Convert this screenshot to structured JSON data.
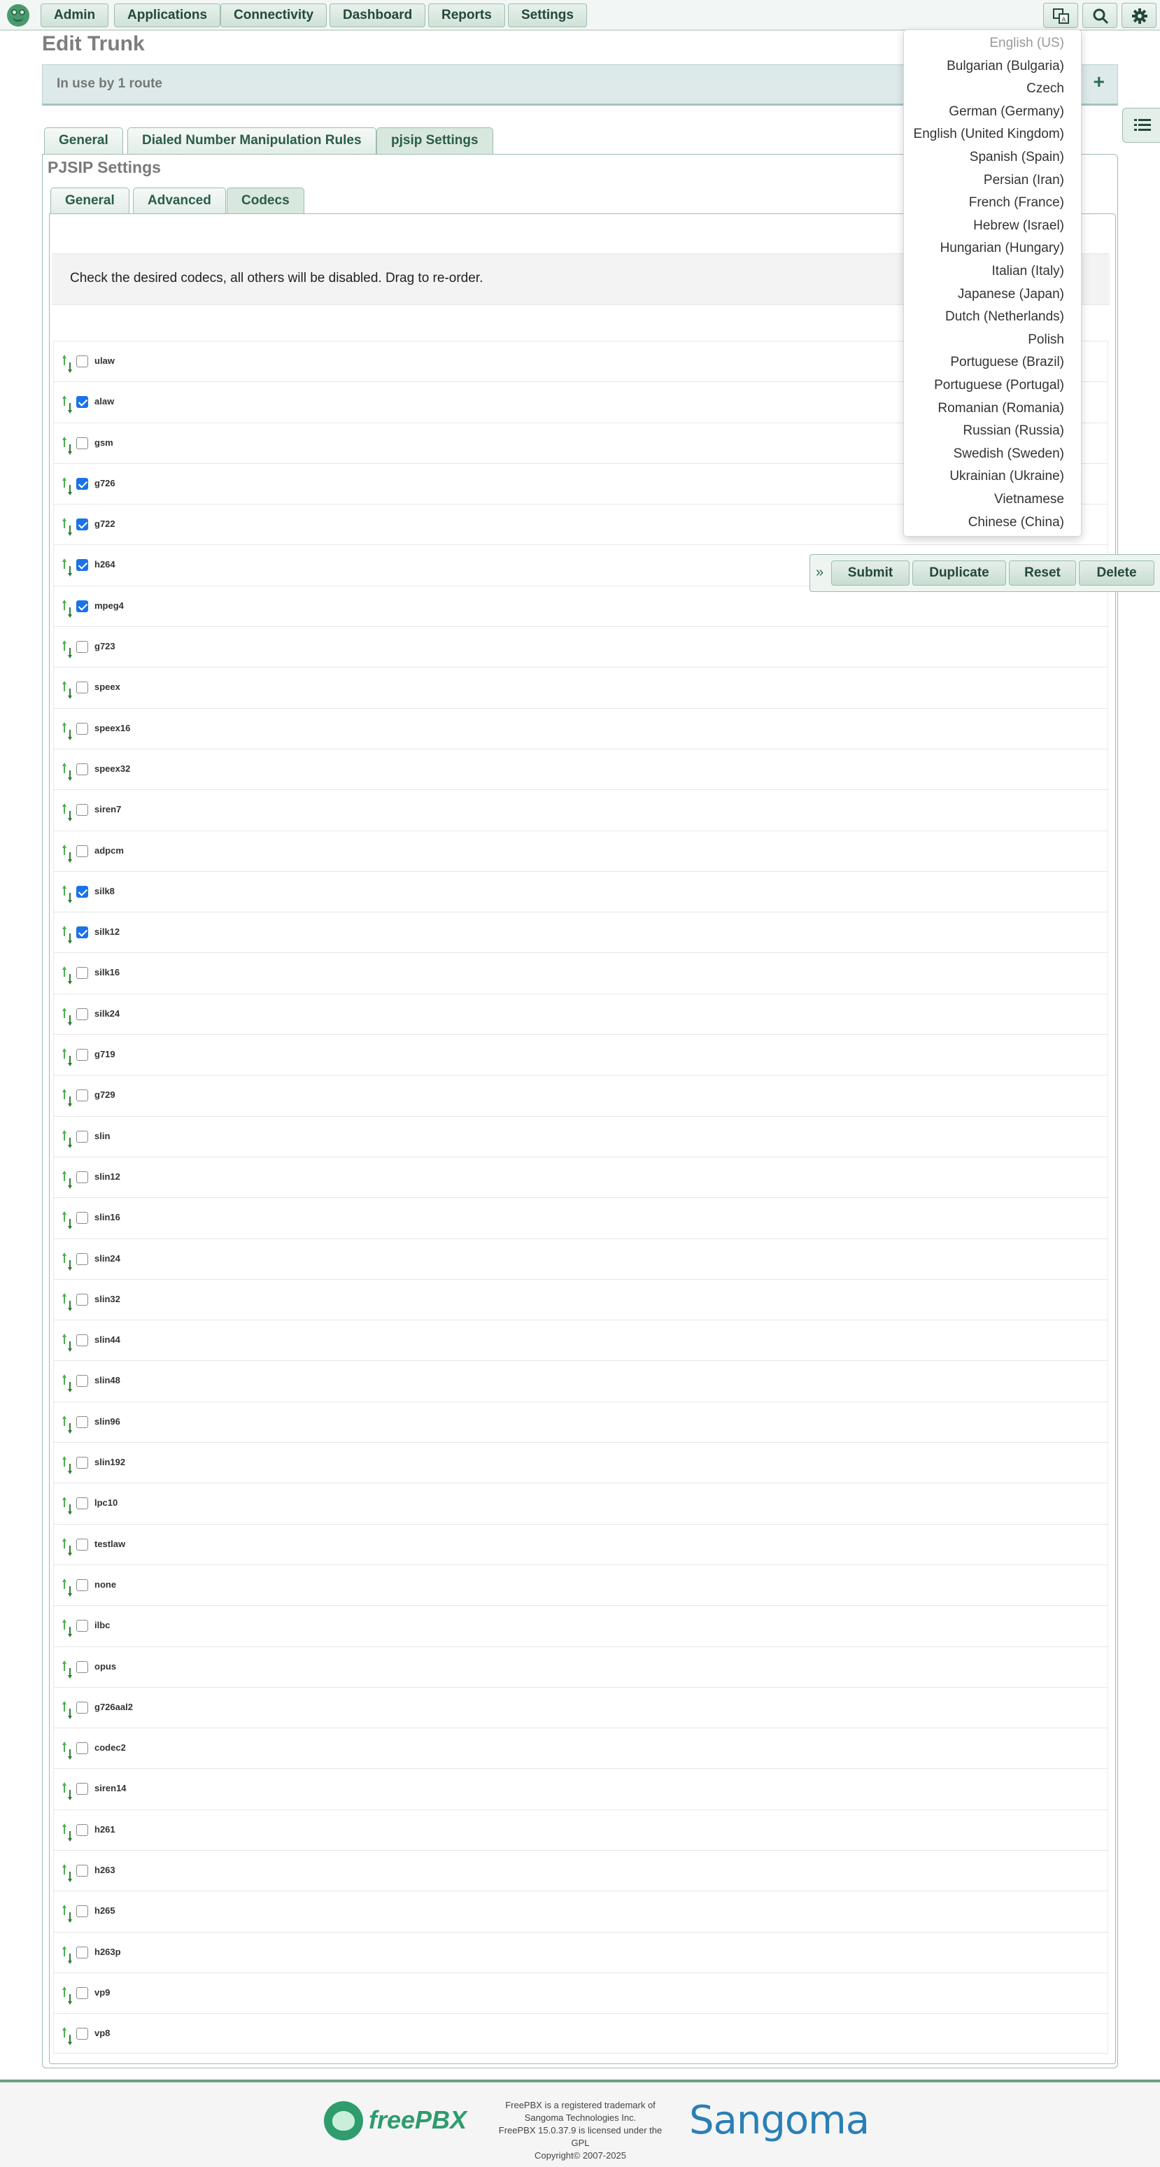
{
  "nav": {
    "items": [
      "Admin",
      "Applications",
      "Connectivity",
      "Dashboard",
      "Reports",
      "Settings"
    ]
  },
  "page": {
    "title": "Edit Trunk",
    "in_use": "In use by 1 route"
  },
  "tabs": {
    "outer": [
      "General",
      "Dialed Number Manipulation Rules",
      "pjsip Settings"
    ],
    "section_title": "PJSIP Settings",
    "inner": [
      "General",
      "Advanced",
      "Codecs"
    ]
  },
  "codecs": {
    "hint": "Check the desired codecs, all others will be disabled. Drag to re-order.",
    "list": [
      {
        "name": "ulaw",
        "checked": false
      },
      {
        "name": "alaw",
        "checked": true
      },
      {
        "name": "gsm",
        "checked": false
      },
      {
        "name": "g726",
        "checked": true
      },
      {
        "name": "g722",
        "checked": true
      },
      {
        "name": "h264",
        "checked": true
      },
      {
        "name": "mpeg4",
        "checked": true
      },
      {
        "name": "g723",
        "checked": false
      },
      {
        "name": "speex",
        "checked": false
      },
      {
        "name": "speex16",
        "checked": false
      },
      {
        "name": "speex32",
        "checked": false
      },
      {
        "name": "siren7",
        "checked": false
      },
      {
        "name": "adpcm",
        "checked": false
      },
      {
        "name": "silk8",
        "checked": true
      },
      {
        "name": "silk12",
        "checked": true
      },
      {
        "name": "silk16",
        "checked": false
      },
      {
        "name": "silk24",
        "checked": false
      },
      {
        "name": "g719",
        "checked": false
      },
      {
        "name": "g729",
        "checked": false
      },
      {
        "name": "slin",
        "checked": false
      },
      {
        "name": "slin12",
        "checked": false
      },
      {
        "name": "slin16",
        "checked": false
      },
      {
        "name": "slin24",
        "checked": false
      },
      {
        "name": "slin32",
        "checked": false
      },
      {
        "name": "slin44",
        "checked": false
      },
      {
        "name": "slin48",
        "checked": false
      },
      {
        "name": "slin96",
        "checked": false
      },
      {
        "name": "slin192",
        "checked": false
      },
      {
        "name": "lpc10",
        "checked": false
      },
      {
        "name": "testlaw",
        "checked": false
      },
      {
        "name": "none",
        "checked": false
      },
      {
        "name": "ilbc",
        "checked": false
      },
      {
        "name": "opus",
        "checked": false
      },
      {
        "name": "g726aal2",
        "checked": false
      },
      {
        "name": "codec2",
        "checked": false
      },
      {
        "name": "siren14",
        "checked": false
      },
      {
        "name": "h261",
        "checked": false
      },
      {
        "name": "h263",
        "checked": false
      },
      {
        "name": "h265",
        "checked": false
      },
      {
        "name": "h263p",
        "checked": false
      },
      {
        "name": "vp9",
        "checked": false
      },
      {
        "name": "vp8",
        "checked": false
      }
    ]
  },
  "actions": {
    "submit": "Submit",
    "duplicate": "Duplicate",
    "reset": "Reset",
    "delete": "Delete"
  },
  "language_menu": {
    "items": [
      "English (US)",
      "Bulgarian (Bulgaria)",
      "Czech",
      "German (Germany)",
      "English (United Kingdom)",
      "Spanish (Spain)",
      "Persian (Iran)",
      "French (France)",
      "Hebrew (Israel)",
      "Hungarian (Hungary)",
      "Italian (Italy)",
      "Japanese (Japan)",
      "Dutch (Netherlands)",
      "Polish",
      "Portuguese (Brazil)",
      "Portuguese (Portugal)",
      "Romanian (Romania)",
      "Russian (Russia)",
      "Swedish (Sweden)",
      "Ukrainian (Ukraine)",
      "Vietnamese",
      "Chinese (China)"
    ]
  },
  "footer": {
    "brand": "freePBX",
    "legal": [
      "FreePBX is a registered trademark of",
      "Sangoma Technologies Inc.",
      "FreePBX 15.0.37.9 is licensed under the",
      "GPL",
      "Copyright© 2007-2025"
    ],
    "company": "Sangoma"
  },
  "icons": {
    "logo": "freepbx-frog-icon",
    "language": "language-icon",
    "search": "search-icon",
    "settings": "gear-icon",
    "drag": "drag-arrows-icon",
    "side_menu": "list-icon",
    "expand": "chevron-right-icon",
    "add": "plus-icon"
  },
  "colors": {
    "accent": "#2e9c6d",
    "checkbox": "#1a73e8",
    "nav_text": "#24483a"
  }
}
